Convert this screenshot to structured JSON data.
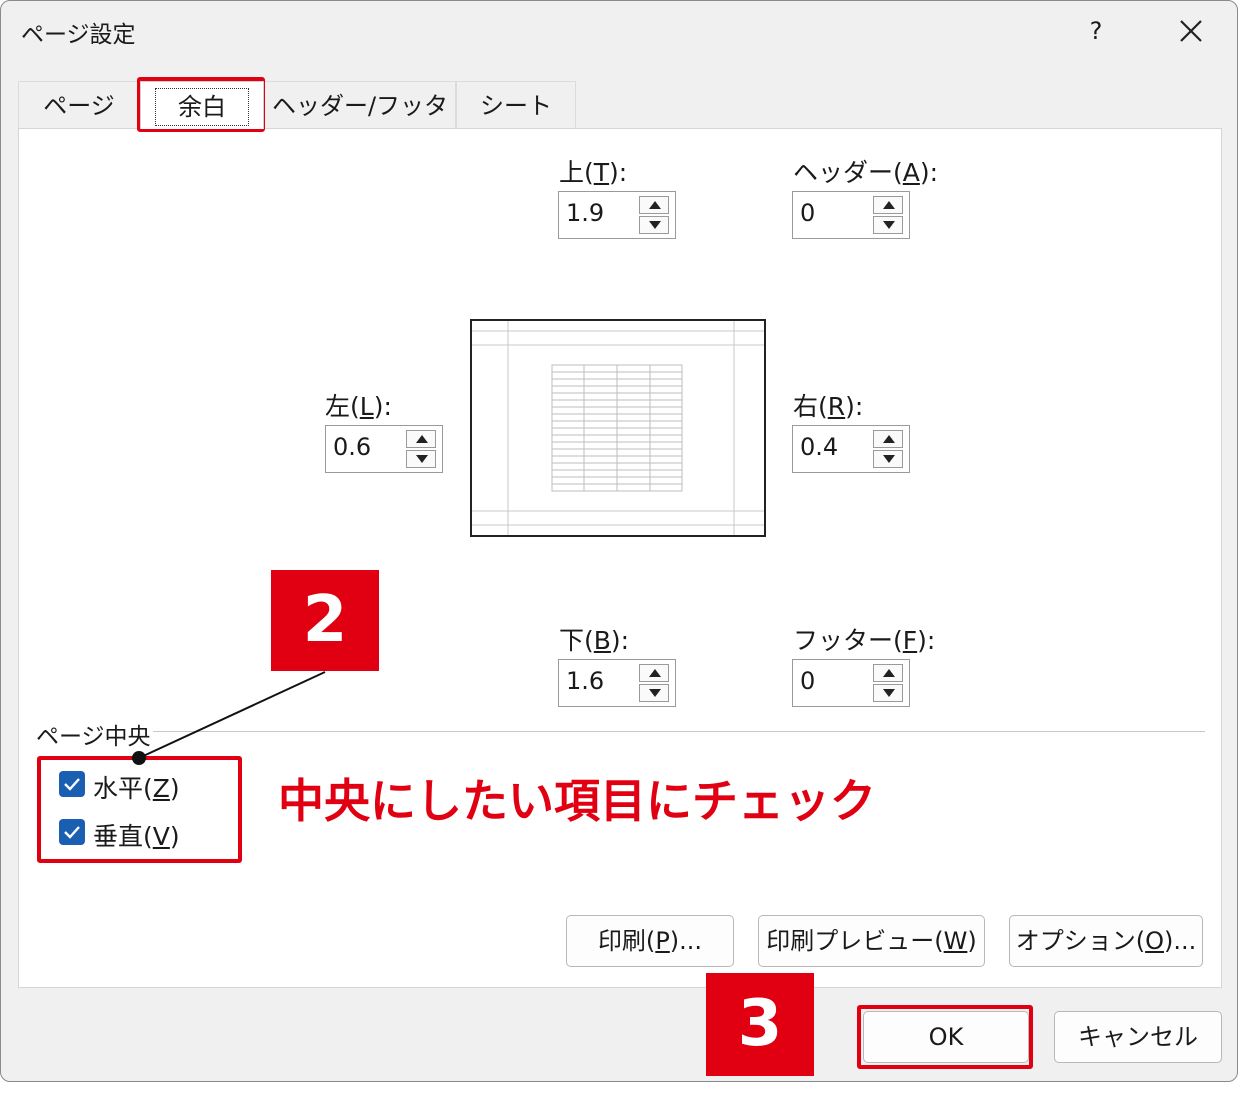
{
  "window": {
    "title": "ページ設定",
    "help": "?",
    "close_icon": "close-icon"
  },
  "tabs": [
    {
      "label": "ページ",
      "active": false
    },
    {
      "label": "余白",
      "active": true
    },
    {
      "label": "ヘッダー/フッター",
      "active": false
    },
    {
      "label": "シート",
      "active": false
    }
  ],
  "margins": {
    "top": {
      "label_pre": "上(",
      "key": "T",
      "label_post": "):",
      "value": "1.9"
    },
    "header": {
      "label_pre": "ヘッダー(",
      "key": "A",
      "label_post": "):",
      "value": "0"
    },
    "left": {
      "label_pre": "左(",
      "key": "L",
      "label_post": "):",
      "value": "0.6"
    },
    "right": {
      "label_pre": "右(",
      "key": "R",
      "label_post": "):",
      "value": "0.4"
    },
    "bottom": {
      "label_pre": "下(",
      "key": "B",
      "label_post": "):",
      "value": "1.6"
    },
    "footer": {
      "label_pre": "フッター(",
      "key": "F",
      "label_post": "):",
      "value": "0"
    }
  },
  "center_on_page": {
    "group_label": "ページ中央",
    "horizontal": {
      "label_pre": "水平(",
      "key": "Z",
      "label_post": ")",
      "checked": true
    },
    "vertical": {
      "label_pre": "垂直(",
      "key": "V",
      "label_post": ")",
      "checked": true
    }
  },
  "buttons": {
    "print": {
      "label_pre": "印刷(",
      "key": "P",
      "label_post": ")..."
    },
    "print_preview": {
      "label_pre": "印刷プレビュー(",
      "key": "W",
      "label_post": ")"
    },
    "options": {
      "label_pre": "オプション(",
      "key": "O",
      "label_post": ")..."
    },
    "ok": "OK",
    "cancel": "キャンセル"
  },
  "annotations": {
    "step2": "2",
    "step3": "3",
    "note": "中央にしたい項目にチェック",
    "highlight_color": "#e00012"
  }
}
